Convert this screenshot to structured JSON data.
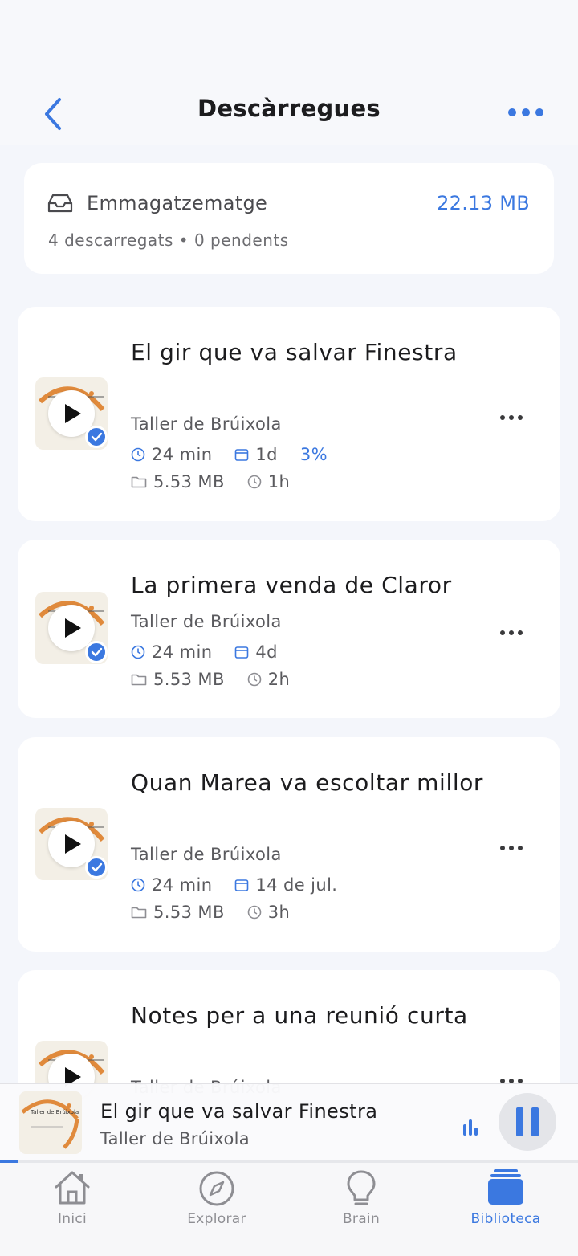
{
  "header": {
    "title": "Descàrregues"
  },
  "storage": {
    "label": "Emmagatzematge",
    "size": "22.13 MB",
    "summary": "4 descarregats • 0 pendents"
  },
  "episodes": [
    {
      "title": "El gir que va salvar Finestra",
      "show": "Taller de Brúixola",
      "duration": "24 min",
      "date": "1d",
      "progress": "3%",
      "size": "5.53 MB",
      "age": "1h",
      "downloaded": true
    },
    {
      "title": "La primera venda de Claror",
      "show": "Taller de Brúixola",
      "duration": "24 min",
      "date": "4d",
      "size": "5.53 MB",
      "age": "2h",
      "downloaded": true
    },
    {
      "title": "Quan Marea va escoltar millor",
      "show": "Taller de Brúixola",
      "duration": "24 min",
      "date": "14 de jul.",
      "size": "5.53 MB",
      "age": "3h",
      "downloaded": true
    },
    {
      "title": "Notes per a una reunió curta",
      "show": "Taller de Brúixola"
    }
  ],
  "thumbnail_text": "Taller de Brúixola",
  "now_playing": {
    "title": "El gir que va salvar Finestra",
    "show": "Taller de Brúixola",
    "progress_fraction": 0.03,
    "state": "playing"
  },
  "tabs": [
    {
      "label": "Inici",
      "icon": "home-icon",
      "active": false
    },
    {
      "label": "Explorar",
      "icon": "compass-icon",
      "active": false
    },
    {
      "label": "Brain",
      "icon": "lightbulb-icon",
      "active": false
    },
    {
      "label": "Biblioteca",
      "icon": "library-icon",
      "active": true
    }
  ],
  "colors": {
    "accent": "#3b78e0",
    "background": "#f4f6fb",
    "card": "#ffffff",
    "thumb_arc": "#e08a3c"
  }
}
